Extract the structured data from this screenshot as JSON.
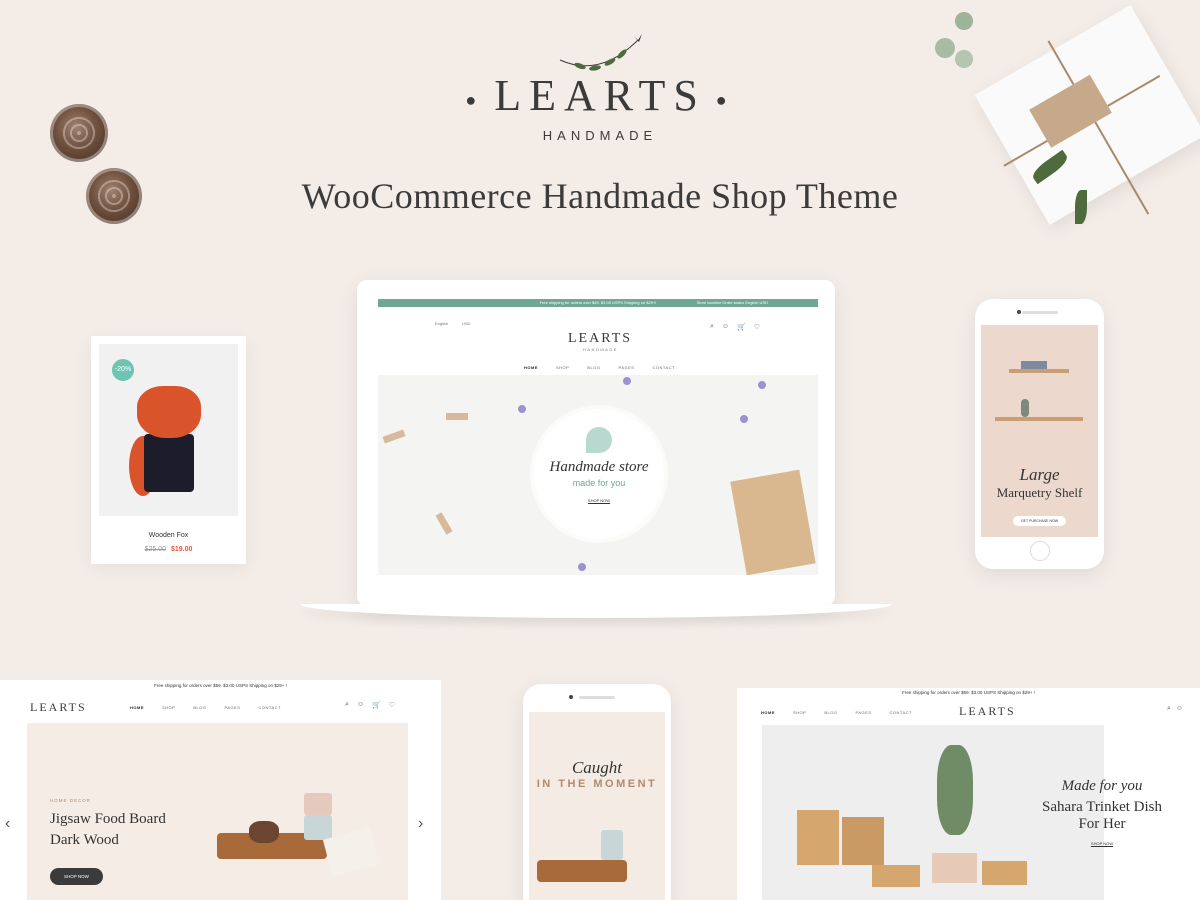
{
  "brand": {
    "logo": "LEARTS",
    "sub": "HANDMADE",
    "tagline": "WooCommerce Handmade Shop Theme"
  },
  "product_card": {
    "badge": "-20%",
    "name": "Wooden Fox",
    "old_price": "$25.00",
    "new_price": "$19.00"
  },
  "laptop": {
    "topbar": "Free shipping for orders over $59. $3.00 USPS Shipping on $29+!",
    "topbar_right": "Store location   Order status   English   USD",
    "lang": "English",
    "currency": "USD",
    "logo": "LEARTS",
    "logo_sub": "HANDMADE",
    "nav": [
      "HOME",
      "SHOP",
      "BLOG",
      "PAGES",
      "CONTACT"
    ],
    "hero": {
      "title": "Handmade store",
      "sub": "made for you",
      "button": "SHOP NOW"
    }
  },
  "phone_right": {
    "script": "Large",
    "title": "Marquetry Shelf",
    "button": "GET PURCHASE NOW"
  },
  "site_left": {
    "topbar": "Free shipping for orders over $59. $3.00 USPS Shipping on $29+ !",
    "logo": "LEARTS",
    "nav": [
      "HOME",
      "SHOP",
      "BLOG",
      "PAGES",
      "CONTACT"
    ],
    "category": "HOME DECOR",
    "title_line1": "Jigsaw Food Board",
    "title_line2": "Dark Wood",
    "button": "SHOP NOW"
  },
  "phone_bottom": {
    "script": "Caught",
    "title": "IN THE MOMENT"
  },
  "site_right": {
    "topbar": "Free shipping for orders over $59. $3.00 USPS Shipping on $29+ !",
    "logo": "LEARTS",
    "nav": [
      "HOME",
      "SHOP",
      "BLOG",
      "PAGES",
      "CONTACT"
    ],
    "script": "Made for you",
    "title_line1": "Sahara Trinket Dish",
    "title_line2": "For Her",
    "button": "SHOP NOW"
  },
  "colors": {
    "background": "#f3ece7",
    "accent": "#6fa696",
    "sale": "#e4573d",
    "dark": "#3b3b3b"
  }
}
